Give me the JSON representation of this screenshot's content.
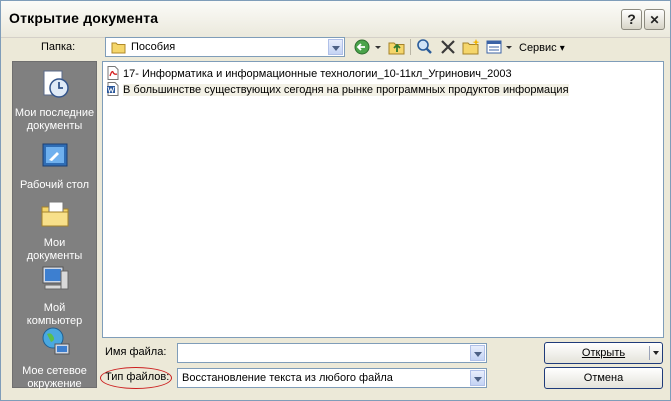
{
  "window": {
    "title": "Открытие документа"
  },
  "titlebar": {
    "help_glyph": "?",
    "close_glyph": "✕"
  },
  "toolbar": {
    "look_in_label": "Папка:",
    "look_in_value": "Пособия",
    "service_label": "Сервис",
    "dropdown_glyph": "▾"
  },
  "places": [
    {
      "label": "Мои последние документы",
      "icon": "recent-documents-icon"
    },
    {
      "label": "Рабочий стол",
      "icon": "desktop-icon"
    },
    {
      "label": "Мои документы",
      "icon": "my-documents-icon"
    },
    {
      "label": "Мой компьютер",
      "icon": "my-computer-icon"
    },
    {
      "label": "Мое сетевое окружение",
      "icon": "network-places-icon"
    }
  ],
  "files": [
    {
      "name": "17- Информатика и информационные технологии_10-11кл_Угринович_2003",
      "type": "pdf"
    },
    {
      "name": "В большинстве существующих сегодня на рынке программных продуктов информация",
      "type": "word"
    }
  ],
  "filename": {
    "label": "Имя файла:",
    "value": ""
  },
  "filetype": {
    "label": "Тип файлов:",
    "value": "Восстановление текста из любого файла"
  },
  "buttons": {
    "open": "Открыть",
    "cancel": "Отмена"
  },
  "colors": {
    "highlight_oval": "#cc1f1f",
    "places_bg": "#808080",
    "dialog_bg": "#ece9d8"
  }
}
